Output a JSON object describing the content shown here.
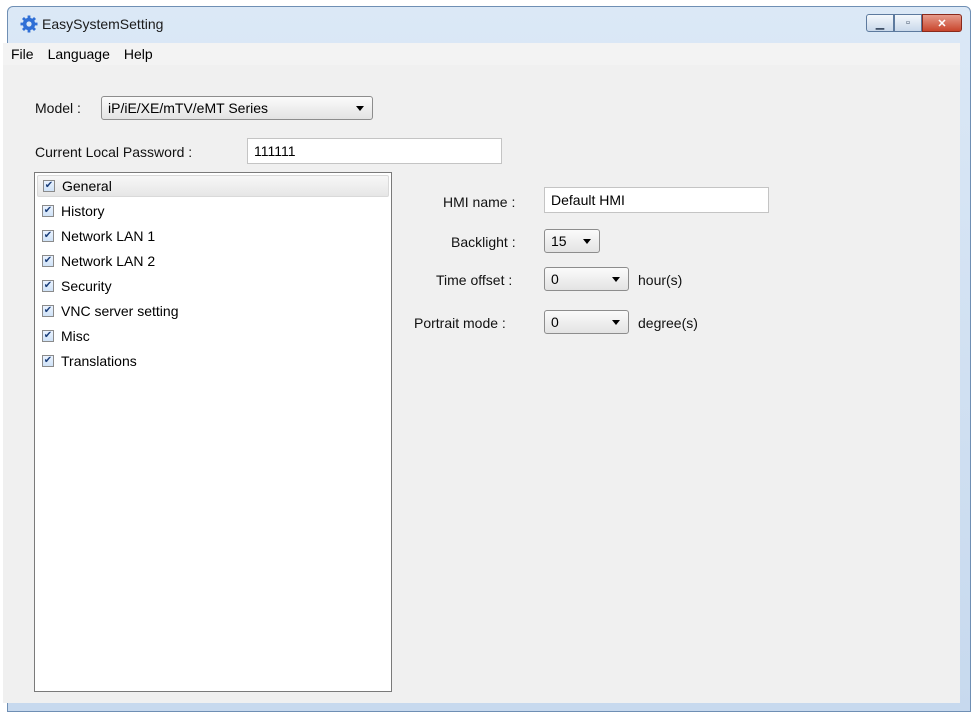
{
  "window": {
    "title": "EasySystemSetting",
    "icon": "gear-icon"
  },
  "menu": {
    "file": "File",
    "language": "Language",
    "help": "Help"
  },
  "model": {
    "label": "Model :",
    "value": "iP/iE/XE/mTV/eMT Series"
  },
  "password": {
    "label": "Current Local Password :",
    "value": "111111"
  },
  "tree": {
    "items": [
      {
        "label": "General",
        "checked": true,
        "selected": true
      },
      {
        "label": "History",
        "checked": true
      },
      {
        "label": "Network LAN 1",
        "checked": true
      },
      {
        "label": "Network LAN 2",
        "checked": true
      },
      {
        "label": "Security",
        "checked": true
      },
      {
        "label": "VNC server setting",
        "checked": true
      },
      {
        "label": "Misc",
        "checked": true
      },
      {
        "label": "Translations",
        "checked": true
      }
    ]
  },
  "general": {
    "hmi_name_label": "HMI name :",
    "hmi_name_value": "Default HMI",
    "backlight_label": "Backlight :",
    "backlight_value": "15",
    "time_offset_label": "Time offset :",
    "time_offset_value": "0",
    "time_offset_unit": "hour(s)",
    "portrait_label": "Portrait mode :",
    "portrait_value": "0",
    "portrait_unit": "degree(s)"
  }
}
